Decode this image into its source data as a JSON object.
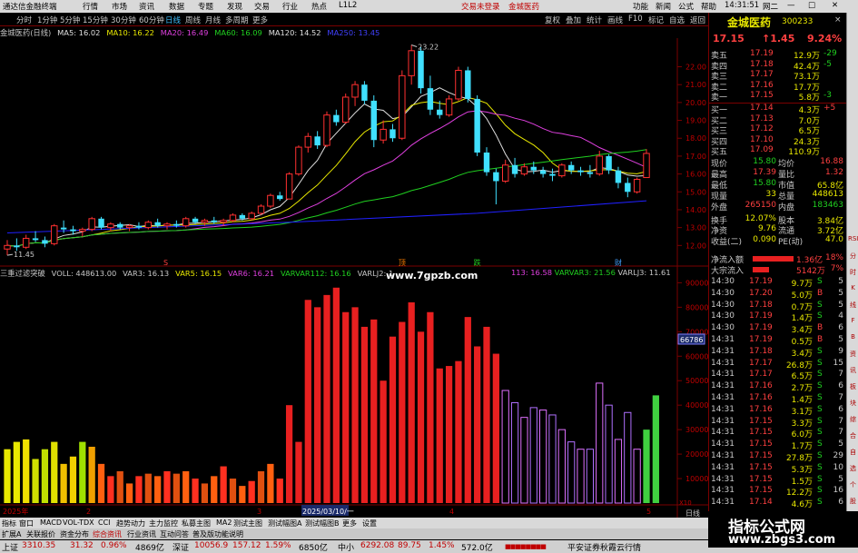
{
  "app": {
    "title": "通达信金融终端",
    "menus": [
      "行情",
      "市场",
      "资讯",
      "数据",
      "专题",
      "发现",
      "交易",
      "行业",
      "热点",
      "L1L2"
    ],
    "login_text": "交易未登录",
    "stock_title": "金城医药",
    "right_menus": [
      "功能",
      "新闻",
      "公式",
      "帮助"
    ],
    "clock": "14:31:51",
    "window_tab": "网二"
  },
  "toolbar": {
    "timeframes": [
      "分时",
      "1分钟",
      "5分钟",
      "15分钟",
      "30分钟",
      "60分钟",
      "日线",
      "周线",
      "月线",
      "多周期",
      "更多"
    ],
    "active_timeframe": "日线",
    "actions": [
      "复权",
      "叠加",
      "统计",
      "画线",
      "F10",
      "标记",
      "自选",
      "返回"
    ]
  },
  "main_legend": [
    {
      "text": "金城医药(日线)",
      "color": "#c8c8c8"
    },
    {
      "text": "MA5: 16.02",
      "color": "#e0e0e0"
    },
    {
      "text": "MA10: 16.22",
      "color": "#e8e800"
    },
    {
      "text": "MA20: 16.49",
      "color": "#e040e0"
    },
    {
      "text": "MA60: 16.09",
      "color": "#20d020"
    },
    {
      "text": "MA120: 14.52",
      "color": "#e0e0e0"
    },
    {
      "text": "MA250: 13.45",
      "color": "#4040ff"
    }
  ],
  "sub_legend": [
    {
      "text": "三重过滤突破",
      "color": "#c8c8c8"
    },
    {
      "text": "VOLL: 448613.00",
      "color": "#c8c8c8"
    },
    {
      "text": "VAR3: 16.13",
      "color": "#c8c8c8"
    },
    {
      "text": "VAR5: 16.15",
      "color": "#e8e800"
    },
    {
      "text": "VAR6: 16.21",
      "color": "#e040e0"
    },
    {
      "text": "VARVAR112: 16.16",
      "color": "#20d020"
    },
    {
      "text": "VARLJ2: 1",
      "color": "#c8c8c8"
    },
    {
      "text": "113: 16.58",
      "color": "#e040e0"
    },
    {
      "text": "VARVAR3: 21.56",
      "color": "#20d020"
    },
    {
      "text": "VARLJ3: 11.61",
      "color": "#c8c8c8"
    }
  ],
  "watermark": {
    "text": "www.7gpzb.com"
  },
  "kline_chart": {
    "y_ticks": [
      "22.00",
      "21.00",
      "20.00",
      "19.00",
      "18.00",
      "17.00",
      "16.00",
      "15.00",
      "14.00",
      "13.00",
      "12.00"
    ],
    "high_label": "23.22",
    "low_label": "11.45",
    "markers": [
      {
        "text": "S",
        "color": "#ff4040"
      },
      {
        "text": "顶",
        "color": "#ff8000"
      },
      {
        "text": "跌",
        "color": "#20d020"
      },
      {
        "text": "财",
        "color": "#40a0ff"
      }
    ]
  },
  "volume_chart": {
    "y_ticks": [
      "90000",
      "80000",
      "70000",
      "60000",
      "50000",
      "40000",
      "30000",
      "20000",
      "10000"
    ],
    "cursor_value": "66786",
    "x_labels": [
      "2025年",
      "2",
      "3",
      "2025/03/10/一",
      "4",
      "5"
    ],
    "unit_label": "X10",
    "bottom_right": "日线"
  },
  "chart_data": [
    {
      "type": "candlestick",
      "title": "金城医药(日线)",
      "ylim": [
        11.0,
        23.5
      ],
      "series": [
        {
          "name": "K",
          "ohlc": [
            [
              11.8,
              12.3,
              11.45,
              12.0
            ],
            [
              12.0,
              12.4,
              11.7,
              11.9
            ],
            [
              11.9,
              12.6,
              11.8,
              12.4
            ],
            [
              12.4,
              12.8,
              12.2,
              12.3
            ],
            [
              12.3,
              12.5,
              11.9,
              12.1
            ],
            [
              12.1,
              13.2,
              12.0,
              13.1
            ],
            [
              13.0,
              13.4,
              12.7,
              12.9
            ],
            [
              12.9,
              13.1,
              12.6,
              12.8
            ],
            [
              12.8,
              13.0,
              12.5,
              12.9
            ],
            [
              12.9,
              13.6,
              12.8,
              13.5
            ],
            [
              13.5,
              13.6,
              12.9,
              13.0
            ],
            [
              13.0,
              13.3,
              12.8,
              13.2
            ],
            [
              13.2,
              13.3,
              12.9,
              13.0
            ],
            [
              13.0,
              13.2,
              12.8,
              13.1
            ],
            [
              13.1,
              13.3,
              12.9,
              13.0
            ],
            [
              13.0,
              13.4,
              12.9,
              13.3
            ],
            [
              13.3,
              13.5,
              13.0,
              13.1
            ],
            [
              13.1,
              13.3,
              12.9,
              13.2
            ],
            [
              13.2,
              13.4,
              13.0,
              13.1
            ],
            [
              13.1,
              13.6,
              13.0,
              13.5
            ],
            [
              13.5,
              13.6,
              13.2,
              13.3
            ],
            [
              13.3,
              13.5,
              13.1,
              13.4
            ],
            [
              13.4,
              13.6,
              13.2,
              13.3
            ],
            [
              13.3,
              13.5,
              13.1,
              13.4
            ],
            [
              13.4,
              13.8,
              13.3,
              13.7
            ],
            [
              13.7,
              13.8,
              13.4,
              13.5
            ],
            [
              13.5,
              13.9,
              13.4,
              13.8
            ],
            [
              13.8,
              14.3,
              13.7,
              14.2
            ],
            [
              14.2,
              14.9,
              14.1,
              14.8
            ],
            [
              14.8,
              15.0,
              14.5,
              14.6
            ],
            [
              14.6,
              16.1,
              14.6,
              16.0
            ],
            [
              16.0,
              17.6,
              15.9,
              17.5
            ],
            [
              17.5,
              18.3,
              17.2,
              18.1
            ],
            [
              18.1,
              18.4,
              17.4,
              17.6
            ],
            [
              17.6,
              19.5,
              17.5,
              19.3
            ],
            [
              19.3,
              19.6,
              18.7,
              18.9
            ],
            [
              18.9,
              20.5,
              18.8,
              20.3
            ],
            [
              20.3,
              21.2,
              19.8,
              21.0
            ],
            [
              21.0,
              21.2,
              19.9,
              20.1
            ],
            [
              20.1,
              20.4,
              17.5,
              17.9
            ],
            [
              17.9,
              19.0,
              17.7,
              18.5
            ],
            [
              18.5,
              18.8,
              17.8,
              18.0
            ],
            [
              18.0,
              21.8,
              17.9,
              21.5
            ],
            [
              21.5,
              23.22,
              21.0,
              22.9
            ],
            [
              22.9,
              23.1,
              20.5,
              20.8
            ],
            [
              20.8,
              21.5,
              19.3,
              19.6
            ],
            [
              19.6,
              20.1,
              19.1,
              19.3
            ],
            [
              19.3,
              20.4,
              19.2,
              20.2
            ],
            [
              20.2,
              22.0,
              20.1,
              21.8
            ],
            [
              21.8,
              22.0,
              20.0,
              20.2
            ],
            [
              20.2,
              20.4,
              17.0,
              17.2
            ],
            [
              17.2,
              17.5,
              15.9,
              16.1
            ],
            [
              16.1,
              16.3,
              14.3,
              15.6
            ],
            [
              15.6,
              16.8,
              15.5,
              16.5
            ],
            [
              16.5,
              16.9,
              15.8,
              16.0
            ],
            [
              16.0,
              16.6,
              15.9,
              16.4
            ],
            [
              16.4,
              16.7,
              16.0,
              16.2
            ],
            [
              16.2,
              16.4,
              15.8,
              16.0
            ],
            [
              16.0,
              16.3,
              15.6,
              15.9
            ],
            [
              15.9,
              16.6,
              15.8,
              16.5
            ],
            [
              16.5,
              16.7,
              16.0,
              16.2
            ],
            [
              16.2,
              16.4,
              15.9,
              16.1
            ],
            [
              16.1,
              16.5,
              15.8,
              16.0
            ],
            [
              16.0,
              17.3,
              15.9,
              17.0
            ],
            [
              17.0,
              17.1,
              16.0,
              16.2
            ],
            [
              16.2,
              16.4,
              15.2,
              15.5
            ],
            [
              15.5,
              15.8,
              14.7,
              15.0
            ],
            [
              15.0,
              15.8,
              14.9,
              15.7
            ],
            [
              15.8,
              17.39,
              15.8,
              17.15
            ]
          ]
        }
      ]
    },
    {
      "type": "bar",
      "title": "三重过滤突破",
      "ylim": [
        0,
        92000
      ],
      "series": [
        {
          "name": "VOLL",
          "values": [
            22000,
            25000,
            26000,
            18000,
            22000,
            25000,
            16000,
            19000,
            25000,
            23000,
            16000,
            11000,
            13000,
            8000,
            11000,
            12000,
            11000,
            13000,
            12000,
            13000,
            10000,
            8000,
            11000,
            15000,
            10000,
            7000,
            9000,
            13000,
            16000,
            10000,
            40000,
            25000,
            83000,
            80000,
            85000,
            88000,
            78000,
            80000,
            72000,
            75000,
            50000,
            68000,
            74000,
            82000,
            70000,
            78000,
            55000,
            56000,
            58000,
            76000,
            64000,
            72000,
            61000,
            46000,
            41000,
            35000,
            39000,
            38000,
            36000,
            30000,
            25000,
            22000,
            22000,
            49000,
            40000,
            26000,
            37000,
            22000,
            30000,
            44000
          ]
        }
      ]
    }
  ],
  "quote": {
    "name": "金城医药",
    "code": "300233",
    "price": "17.15",
    "change": "↑1.45",
    "pct": "9.24%",
    "sell": [
      {
        "label": "卖五",
        "price": "17.19",
        "vol": "12.9万"
      },
      {
        "label": "卖四",
        "price": "17.18",
        "vol": "42.4万"
      },
      {
        "label": "卖三",
        "price": "17.17",
        "vol": "73.1万"
      },
      {
        "label": "卖二",
        "price": "17.16",
        "vol": "17.7万"
      },
      {
        "label": "卖一",
        "price": "17.15",
        "vol": "5.8万"
      }
    ],
    "buy": [
      {
        "label": "买一",
        "price": "17.14",
        "vol": "4.3万"
      },
      {
        "label": "买二",
        "price": "17.13",
        "vol": "7.0万"
      },
      {
        "label": "买三",
        "price": "17.12",
        "vol": "6.5万"
      },
      {
        "label": "买四",
        "price": "17.10",
        "vol": "24.3万"
      },
      {
        "label": "买五",
        "price": "17.09",
        "vol": "110.9万"
      }
    ],
    "side_marks": [
      "-29",
      "-5",
      "",
      "",
      "-3",
      "+5",
      "",
      "",
      "",
      ""
    ],
    "stats": [
      {
        "k1": "现价",
        "v1": "15.80",
        "k2": "均价",
        "v2": "16.88",
        "c1": "#20d020",
        "c2": "#ff4040"
      },
      {
        "k1": "最高",
        "v1": "17.39",
        "k2": "量比",
        "v2": "1.32",
        "c1": "#ff4040",
        "c2": "#ff4040"
      },
      {
        "k1": "最低",
        "v1": "15.80",
        "k2": "市值",
        "v2": "65.8亿",
        "c1": "#20d020",
        "c2": "#e8e800"
      },
      {
        "k1": "现量",
        "v1": "33",
        "k2": "总量",
        "v2": "448613",
        "c1": "#e8e800",
        "c2": "#e8e800"
      },
      {
        "k1": "外盘",
        "v1": "265150",
        "k2": "内盘",
        "v2": "183463",
        "c1": "#ff4040",
        "c2": "#20d020"
      },
      {
        "k1": "换手",
        "v1": "12.07%",
        "k2": "股本",
        "v2": "3.84亿",
        "c1": "#e8e800",
        "c2": "#e8e800"
      },
      {
        "k1": "净资",
        "v1": "9.76",
        "k2": "流通",
        "v2": "3.72亿",
        "c1": "#e8e800",
        "c2": "#e8e800"
      },
      {
        "k1": "收益(二)",
        "v1": "0.090",
        "k2": "PE(动)",
        "v2": "47.0",
        "c1": "#e8e800",
        "c2": "#e8e800"
      }
    ],
    "flows": [
      {
        "label": "净流入额",
        "value": "1.36亿",
        "pct": "18%",
        "bar": 0.18
      },
      {
        "label": "大宗流入",
        "value": "5142万",
        "pct": "7%",
        "bar": 0.07
      }
    ],
    "ticks": [
      {
        "t": "14:30",
        "p": "17.19",
        "v": "9.7万",
        "d": "S",
        "n": "5"
      },
      {
        "t": "14:30",
        "p": "17.20",
        "v": "5.0万",
        "d": "B",
        "n": "5"
      },
      {
        "t": "14:30",
        "p": "17.18",
        "v": "0.7万",
        "d": "S",
        "n": "5"
      },
      {
        "t": "14:30",
        "p": "17.19",
        "v": "1.4万",
        "d": "S",
        "n": "4"
      },
      {
        "t": "14:30",
        "p": "17.19",
        "v": "3.4万",
        "d": "B",
        "n": "6"
      },
      {
        "t": "14:31",
        "p": "17.19",
        "v": "0.5万",
        "d": "B",
        "n": "5"
      },
      {
        "t": "14:31",
        "p": "17.18",
        "v": "3.4万",
        "d": "S",
        "n": "9"
      },
      {
        "t": "14:31",
        "p": "17.17",
        "v": "26.8万",
        "d": "S",
        "n": "15"
      },
      {
        "t": "14:31",
        "p": "17.17",
        "v": "6.5万",
        "d": "S",
        "n": "7"
      },
      {
        "t": "14:31",
        "p": "17.16",
        "v": "2.7万",
        "d": "S",
        "n": "6"
      },
      {
        "t": "14:31",
        "p": "17.16",
        "v": "1.4万",
        "d": "S",
        "n": "7"
      },
      {
        "t": "14:31",
        "p": "17.16",
        "v": "3.1万",
        "d": "S",
        "n": "6"
      },
      {
        "t": "14:31",
        "p": "17.15",
        "v": "3.3万",
        "d": "S",
        "n": "7"
      },
      {
        "t": "14:31",
        "p": "17.15",
        "v": "6.0万",
        "d": "S",
        "n": "7"
      },
      {
        "t": "14:31",
        "p": "17.15",
        "v": "1.7万",
        "d": "S",
        "n": "5"
      },
      {
        "t": "14:31",
        "p": "17.15",
        "v": "27.8万",
        "d": "S",
        "n": "29"
      },
      {
        "t": "14:31",
        "p": "17.15",
        "v": "5.3万",
        "d": "S",
        "n": "10"
      },
      {
        "t": "14:31",
        "p": "17.15",
        "v": "1.5万",
        "d": "S",
        "n": "5"
      },
      {
        "t": "14:31",
        "p": "17.15",
        "v": "12.2万",
        "d": "S",
        "n": "16"
      },
      {
        "t": "14:31",
        "p": "17.14",
        "v": "4.6万",
        "d": "S",
        "n": "6"
      }
    ]
  },
  "bottom_tabs": [
    "指标",
    "窗口",
    "MACD",
    "VOL-TDX",
    "CCI",
    "趋势动力",
    "主力监控",
    "私募主图",
    "MA2",
    "测试主图",
    "测试幅图A",
    "测试幅图B",
    "更多",
    "设置"
  ],
  "bottom_tabs2": [
    "扩展A",
    "关联报价",
    "资金分布",
    "综合资讯",
    "行业资讯",
    "互动问答",
    "普及版功能说明"
  ],
  "sidebar_tabs": [
    "RSI",
    "分",
    "时",
    "K",
    "线",
    "F",
    "B",
    "资",
    "讯",
    "板",
    "块",
    "综",
    "合",
    "自",
    "选",
    "个",
    "股"
  ],
  "statusbar": {
    "indices": [
      {
        "name": "上证",
        "value": "3310.35",
        "chg": "31.32",
        "pct": "0.96%",
        "amt": "4869亿"
      },
      {
        "name": "深证",
        "value": "10056.9",
        "chg": "157.12",
        "pct": "1.59%",
        "amt": "6850亿"
      },
      {
        "name": "中小",
        "value": "6292.08",
        "chg": "89.75",
        "pct": "1.45%",
        "amt": "572.0亿"
      }
    ],
    "server": "平安证券秋霞云行情"
  },
  "corner_watermark": {
    "title": "指标公式网",
    "url": "www.zbgs3.com"
  }
}
